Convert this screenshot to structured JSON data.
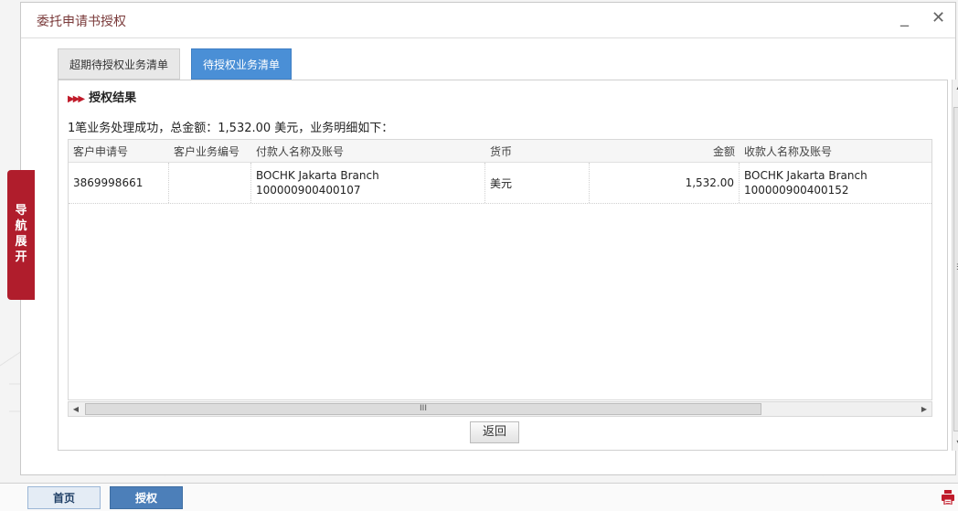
{
  "window": {
    "title": "委托申请书授权",
    "minimize_glyph": "_",
    "close_glyph": "✕"
  },
  "tabs": [
    {
      "label": "超期待授权业务清单",
      "active": false
    },
    {
      "label": "待授权业务清单",
      "active": true
    }
  ],
  "section": {
    "heading": "授权结果",
    "arrows": "▶▶▶"
  },
  "summary": "1笔业务处理成功，总金额：1,532.00 美元，业务明细如下：",
  "table": {
    "headers": [
      "客户申请号",
      "客户业务编号",
      "付款人名称及账号",
      "货币",
      "金额",
      "收款人名称及账号"
    ],
    "rows": [
      {
        "app_no": "3869998661",
        "biz_no": "",
        "payer_name": "BOCHK Jakarta Branch",
        "payer_account": "100000900400107",
        "currency": "美元",
        "amount": "1,532.00",
        "payee_name": "BOCHK Jakarta Branch",
        "payee_account": "100000900400152"
      }
    ]
  },
  "hscroll": {
    "grip": "III"
  },
  "vscroll": {
    "grip": "☰"
  },
  "return_button": "返回",
  "nav_toggle": "导航展开",
  "bottom_tabs": [
    {
      "label": "首页",
      "active": false
    },
    {
      "label": "授权",
      "active": true
    }
  ],
  "colors": {
    "accent_red": "#b01d2c",
    "tab_blue": "#4a8fd6",
    "title_color": "#7a3a3a"
  },
  "icons": {
    "printer": "printer-icon",
    "minimize": "minimize-icon",
    "close": "close-icon"
  }
}
